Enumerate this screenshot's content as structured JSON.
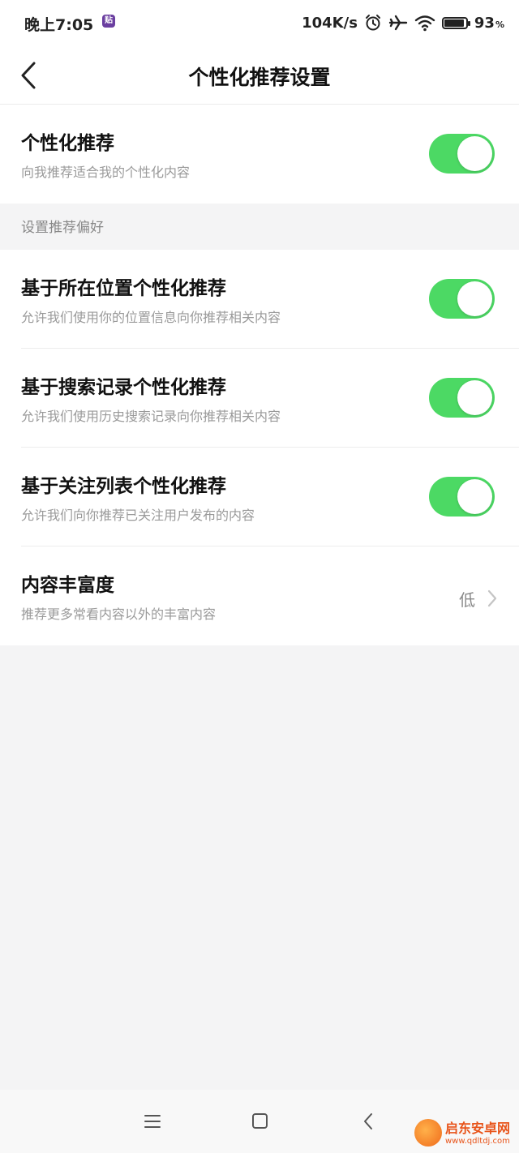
{
  "status_bar": {
    "time": "晚上7:05",
    "app_icon_text": "贴",
    "net_speed": "104K/s",
    "battery_percent": "93",
    "battery_unit": "%",
    "battery_level": 0.93,
    "icons": [
      "alarm-icon",
      "airplane-icon",
      "wifi-icon",
      "battery-icon"
    ]
  },
  "header": {
    "title": "个性化推荐设置",
    "back_icon": "chevron-left-icon"
  },
  "main_toggle": {
    "title": "个性化推荐",
    "description": "向我推荐适合我的个性化内容",
    "enabled": true
  },
  "preferences": {
    "section_label": "设置推荐偏好",
    "items": [
      {
        "title": "基于所在位置个性化推荐",
        "description": "允许我们使用你的位置信息向你推荐相关内容",
        "enabled": true
      },
      {
        "title": "基于搜索记录个性化推荐",
        "description": "允许我们使用历史搜索记录向你推荐相关内容",
        "enabled": true
      },
      {
        "title": "基于关注列表个性化推荐",
        "description": "允许我们向你推荐已关注用户发布的内容",
        "enabled": true
      }
    ],
    "richness": {
      "title": "内容丰富度",
      "description": "推荐更多常看内容以外的丰富内容",
      "value": "低"
    }
  },
  "nav_bar": {
    "buttons": [
      "menu-icon",
      "home-square-icon",
      "back-triangle-icon"
    ]
  },
  "watermark": {
    "title": "启东安卓网",
    "url": "www.qdltdj.com"
  },
  "colors": {
    "toggle_on": "#4cd964",
    "background": "#f4f4f5",
    "watermark": "#e8541a"
  }
}
